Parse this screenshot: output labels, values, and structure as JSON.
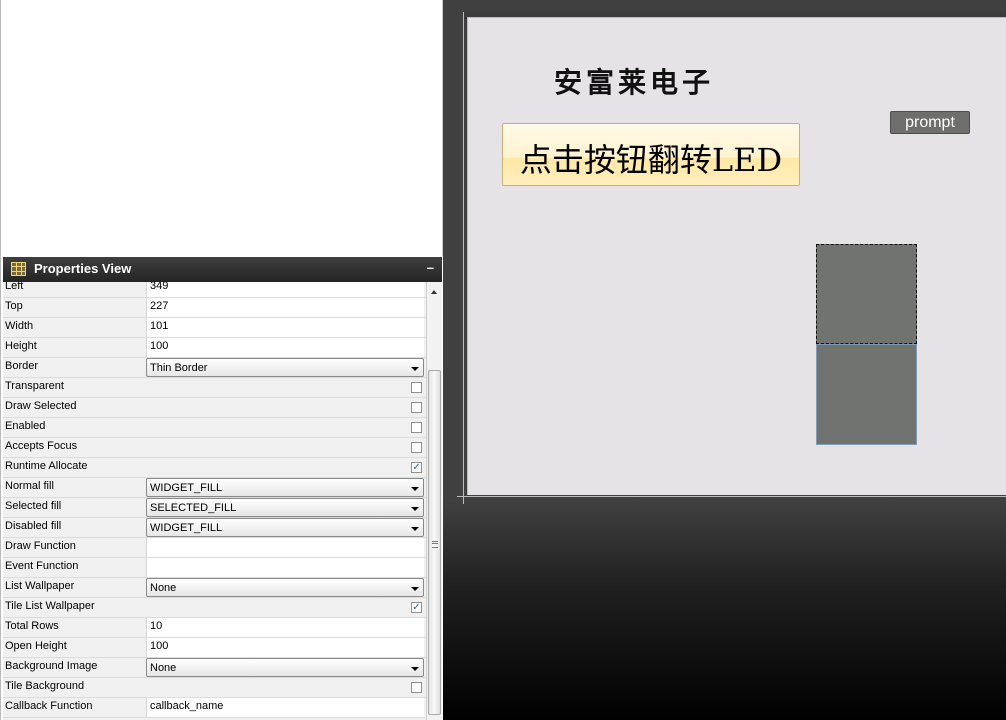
{
  "properties_view": {
    "title": "Properties View",
    "minimize_label": "–",
    "rows": [
      {
        "label": "Left",
        "type": "text",
        "value": "349"
      },
      {
        "label": "Top",
        "type": "text",
        "value": "227"
      },
      {
        "label": "Width",
        "type": "text",
        "value": "101"
      },
      {
        "label": "Height",
        "type": "text",
        "value": "100"
      },
      {
        "label": "Border",
        "type": "select",
        "value": "Thin Border"
      },
      {
        "label": "Transparent",
        "type": "check",
        "checked": false
      },
      {
        "label": "Draw Selected",
        "type": "check",
        "checked": false
      },
      {
        "label": "Enabled",
        "type": "check",
        "checked": false
      },
      {
        "label": "Accepts Focus",
        "type": "check",
        "checked": false
      },
      {
        "label": "Runtime Allocate",
        "type": "check",
        "checked": true
      },
      {
        "label": "Normal fill",
        "type": "select",
        "value": "WIDGET_FILL"
      },
      {
        "label": "Selected fill",
        "type": "select",
        "value": "SELECTED_FILL"
      },
      {
        "label": "Disabled fill",
        "type": "select",
        "value": "WIDGET_FILL"
      },
      {
        "label": "Draw Function",
        "type": "text",
        "value": ""
      },
      {
        "label": "Event Function",
        "type": "text",
        "value": ""
      },
      {
        "label": "List Wallpaper",
        "type": "select",
        "value": "None"
      },
      {
        "label": "Tile List Wallpaper",
        "type": "check",
        "checked": true
      },
      {
        "label": "Total Rows",
        "type": "text",
        "value": "10"
      },
      {
        "label": "Open Height",
        "type": "text",
        "value": "100"
      },
      {
        "label": "Background Image",
        "type": "select",
        "value": "None"
      },
      {
        "label": "Tile Background",
        "type": "check",
        "checked": false
      },
      {
        "label": "Callback Function",
        "type": "text",
        "value": "callback_name"
      }
    ]
  },
  "canvas": {
    "brand_label": "安富莱电子",
    "main_button_label": "点击按钮翻转LED",
    "prompt_button_label": "prompt"
  },
  "icons": {
    "header": "grid-icon",
    "dropdown": "chevron-down-icon",
    "check": "checkmark-icon"
  },
  "colors": {
    "canvas_bg": "#e6e3e6",
    "widget_gray": "#717370",
    "button_face": "#fff3cf"
  }
}
